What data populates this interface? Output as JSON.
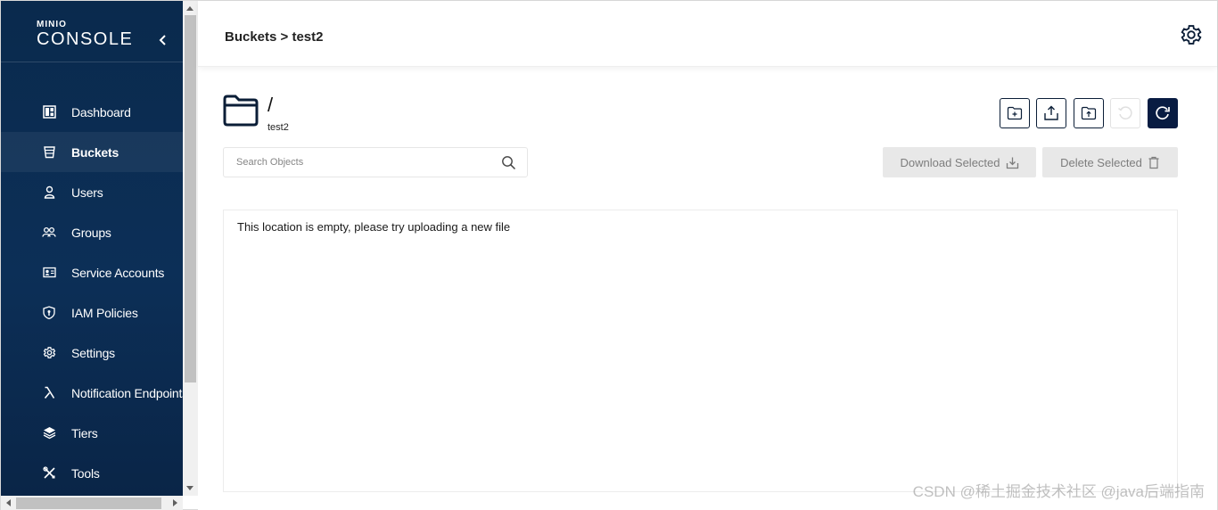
{
  "logo": {
    "brand": "MINIO",
    "product": "CONSOLE"
  },
  "sidebar": {
    "items": [
      {
        "label": "Dashboard",
        "icon": "dashboard-icon",
        "active": false
      },
      {
        "label": "Buckets",
        "icon": "bucket-icon",
        "active": true
      },
      {
        "label": "Users",
        "icon": "user-icon",
        "active": false
      },
      {
        "label": "Groups",
        "icon": "groups-icon",
        "active": false
      },
      {
        "label": "Service Accounts",
        "icon": "service-accounts-icon",
        "active": false
      },
      {
        "label": "IAM Policies",
        "icon": "shield-icon",
        "active": false
      },
      {
        "label": "Settings",
        "icon": "gear-icon",
        "active": false
      },
      {
        "label": "Notification Endpoints",
        "icon": "lambda-icon",
        "active": false
      },
      {
        "label": "Tiers",
        "icon": "layers-icon",
        "active": false
      },
      {
        "label": "Tools",
        "icon": "tools-icon",
        "active": false
      }
    ]
  },
  "header": {
    "breadcrumb": "Buckets > test2"
  },
  "browser": {
    "path": "/",
    "bucket": "test2",
    "search_placeholder": "Search Objects",
    "download_label": "Download Selected",
    "delete_label": "Delete Selected",
    "empty_message": "This location is empty, please try uploading a new file"
  },
  "watermark": "CSDN @稀土掘金技术社区 @java后端指南",
  "colors": {
    "sidebar": "#0c2f57",
    "accent_dark": "#081c42",
    "disabled_button": "#e8e8e8"
  }
}
